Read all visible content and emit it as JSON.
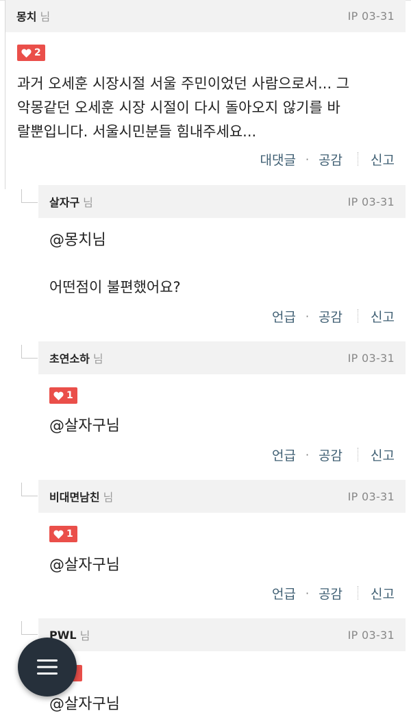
{
  "comments": [
    {
      "author": "몽치",
      "suffix": "님",
      "meta": "IP 03-31",
      "likes": "2",
      "lines": [
        "과거 오세훈 시장시절 서울 주민이었던 사람으로서... 그",
        "악몽같던 오세훈 시장 시절이 다시 돌아오지 않기를 바",
        "랄뿐입니다. 서울시민분들 힘내주세요..."
      ],
      "actions": {
        "reply": "대댓글",
        "dot": "·",
        "like": "공감",
        "report": "신고"
      }
    },
    {
      "author": "살자구",
      "suffix": "님",
      "meta": "IP 03-31",
      "mention": "@몽치님",
      "body": "어떤점이 불편했어요?",
      "actions": {
        "reply": "언급",
        "dot": "·",
        "like": "공감",
        "report": "신고"
      }
    },
    {
      "author": "초연소하",
      "suffix": "님",
      "meta": "IP 03-31",
      "likes": "1",
      "mention": "@살자구님",
      "actions": {
        "reply": "언급",
        "dot": "·",
        "like": "공감",
        "report": "신고"
      }
    },
    {
      "author": "비대면남친",
      "suffix": "님",
      "meta": "IP 03-31",
      "likes": "1",
      "mention": "@살자구님",
      "actions": {
        "reply": "언급",
        "dot": "·",
        "like": "공감",
        "report": "신고"
      }
    },
    {
      "author": "PWL",
      "suffix": "님",
      "meta": "IP 03-31",
      "mention": "@살자구님"
    }
  ],
  "icons": {
    "like": "heart-icon",
    "menu": "hamburger-menu-icon"
  },
  "colors": {
    "like_badge": "#ea4f4a",
    "action_text": "#3f5f73",
    "fab": "#26303b",
    "header_bg": "#f2f2f2"
  }
}
